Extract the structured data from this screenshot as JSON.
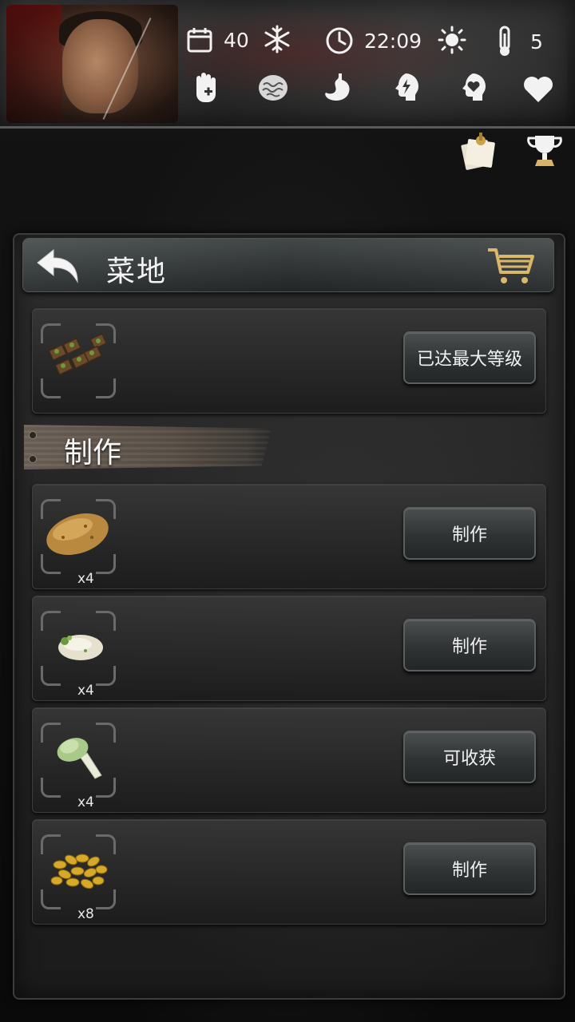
{
  "status_bar": {
    "days_icon": "calendar-icon",
    "days": "40",
    "weather_icon": "snowflake-icon",
    "time_icon": "clock-icon",
    "time": "22:09",
    "daylight_icon": "sun-icon",
    "thermo_icon": "thermometer-icon",
    "temperature": "5",
    "conditions": [
      {
        "name": "health-hand-icon"
      },
      {
        "name": "brain-icon"
      },
      {
        "name": "stomach-icon"
      },
      {
        "name": "energy-head-icon"
      },
      {
        "name": "mood-head-icon"
      },
      {
        "name": "heart-icon"
      }
    ]
  },
  "side_icons": {
    "notes_icon": "notes-icon",
    "trophy_icon": "trophy-icon"
  },
  "panel": {
    "title": "菜地",
    "back_icon": "back-arrow-icon",
    "cart_icon": "shopping-cart-icon",
    "upgrade": {
      "item_icon": "vegetable-beds-icon",
      "button_label": "已达最大等级"
    },
    "section_title": "制作",
    "crafts": [
      {
        "item_icon": "potato-icon",
        "quantity": "x4",
        "button_label": "制作"
      },
      {
        "item_icon": "sprouted-potato-icon",
        "quantity": "x4",
        "button_label": "制作"
      },
      {
        "item_icon": "bok-choy-icon",
        "quantity": "x4",
        "button_label": "可收获"
      },
      {
        "item_icon": "seeds-icon",
        "quantity": "x8",
        "button_label": "制作"
      }
    ]
  },
  "colors": {
    "button_bg": "#2f3334",
    "text": "#f2f2f2",
    "panel_bg": "#1b1b1b"
  }
}
